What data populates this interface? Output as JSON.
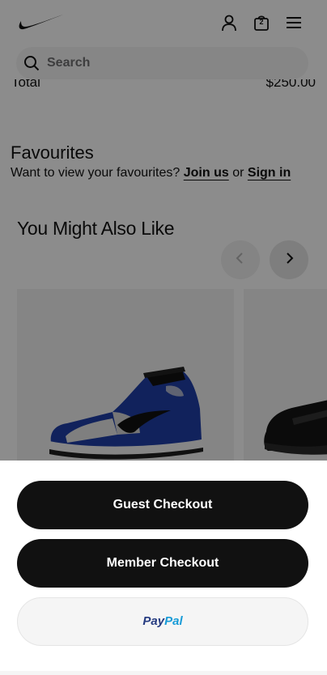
{
  "header": {
    "logo": "nike-swoosh",
    "bag_count": "2",
    "icons": [
      "user-icon",
      "bag-icon",
      "menu-icon"
    ]
  },
  "search": {
    "placeholder": "Search"
  },
  "summary": {
    "total_label": "Total",
    "total_value": "$250.00"
  },
  "favourites": {
    "title": "Favourites",
    "prompt": "Want to view your favourites?",
    "join_label": "Join us",
    "or_text": "or",
    "signin_label": "Sign in"
  },
  "recommendations": {
    "title": "You Might Also Like",
    "prev_icon": "chevron-left-icon",
    "next_icon": "chevron-right-icon",
    "products": [
      {
        "image": "blue-white-black-high-top-sneaker"
      },
      {
        "image": "black-sneaker"
      }
    ]
  },
  "checkout": {
    "guest_label": "Guest Checkout",
    "member_label": "Member Checkout",
    "paypal_pay": "Pay",
    "paypal_pal": "Pal"
  },
  "colors": {
    "primary_button": "#111111",
    "paypal_dark": "#253b80",
    "paypal_light": "#179bd7"
  }
}
